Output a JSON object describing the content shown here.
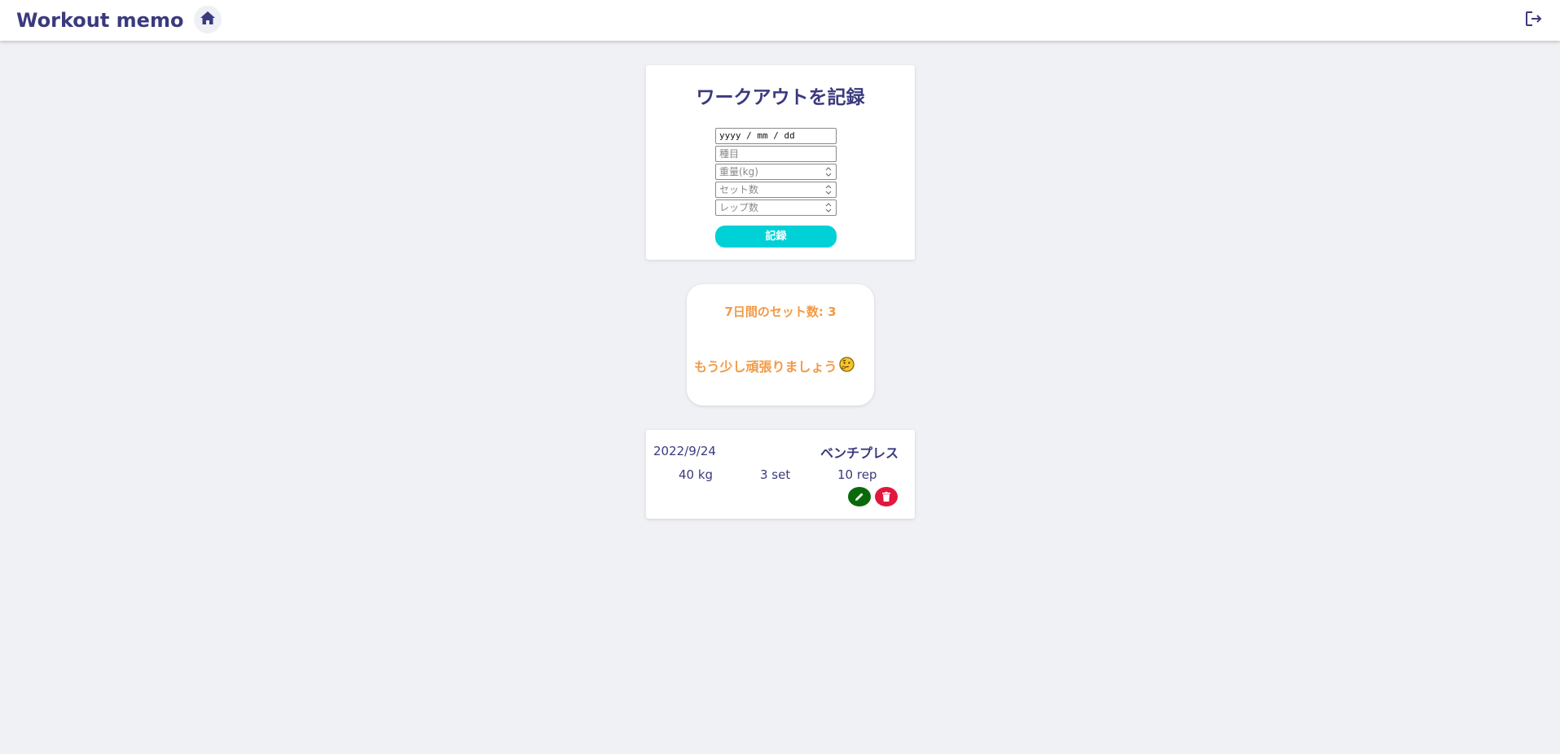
{
  "header": {
    "title": "Workout memo",
    "home_icon": "home-icon",
    "logout_icon": "logout-icon"
  },
  "form": {
    "title": "ワークアウトを記録",
    "date_value": "yyyy / mm / dd",
    "exercise_placeholder": "種目",
    "weight_placeholder": "重量(kg)",
    "sets_placeholder": "セット数",
    "reps_placeholder": "レップ数",
    "submit_label": "記録"
  },
  "summary": {
    "count_text": "7日間のセット数: 3",
    "message": "もう少し頑張りましょう",
    "emoji": "🤔"
  },
  "records": [
    {
      "date": "2022/9/24",
      "exercise": "ベンチプレス",
      "weight": "40 kg",
      "sets": "3 set",
      "reps": "10 rep"
    }
  ],
  "colors": {
    "primary": "#3b3a7e",
    "accent": "#00d1d6",
    "summary_text": "#f29a44",
    "edit": "#0a6a0a",
    "delete": "#e0183e",
    "background": "#f0f1f5"
  }
}
